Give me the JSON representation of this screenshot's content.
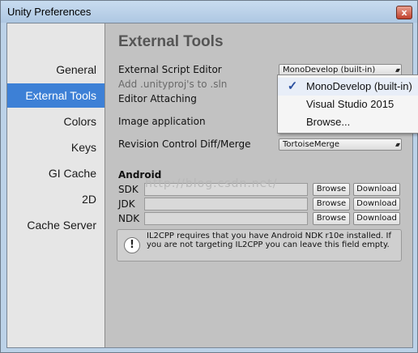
{
  "window": {
    "title": "Unity Preferences",
    "close_glyph": "x"
  },
  "sidebar": {
    "items": [
      {
        "label": "General"
      },
      {
        "label": "External Tools"
      },
      {
        "label": "Colors"
      },
      {
        "label": "Keys"
      },
      {
        "label": "GI Cache"
      },
      {
        "label": "2D"
      },
      {
        "label": "Cache Server"
      }
    ],
    "active_index": 1
  },
  "main": {
    "heading": "External Tools",
    "script_editor_label": "External Script Editor",
    "script_editor_value": "MonoDevelop (built-in)",
    "add_unityproj_label": "Add .unityproj's to .sln",
    "editor_attaching_label": "Editor Attaching",
    "image_app_label": "Image application",
    "revision_label": "Revision Control Diff/Merge",
    "revision_value": "TortoiseMerge",
    "android_heading": "Android",
    "sdk_label": "SDK",
    "jdk_label": "JDK",
    "ndk_label": "NDK",
    "browse_label": "Browse",
    "download_label": "Download",
    "info_text": "IL2CPP requires that you have Android NDK r10e installed. If you are not targeting IL2CPP you can leave this field empty.",
    "watermark": "http://blog.csdn.net/"
  },
  "popup": {
    "items": [
      {
        "label": "MonoDevelop (built-in)",
        "checked": true
      },
      {
        "label": "Visual Studio 2015",
        "checked": false
      },
      {
        "label": "Browse...",
        "checked": false
      }
    ],
    "check_glyph": "✓"
  },
  "colors": {
    "sidebar_active": "#3d80d6",
    "client_bg": "#c2c2c2",
    "sidebar_bg": "#e6e6e6"
  }
}
